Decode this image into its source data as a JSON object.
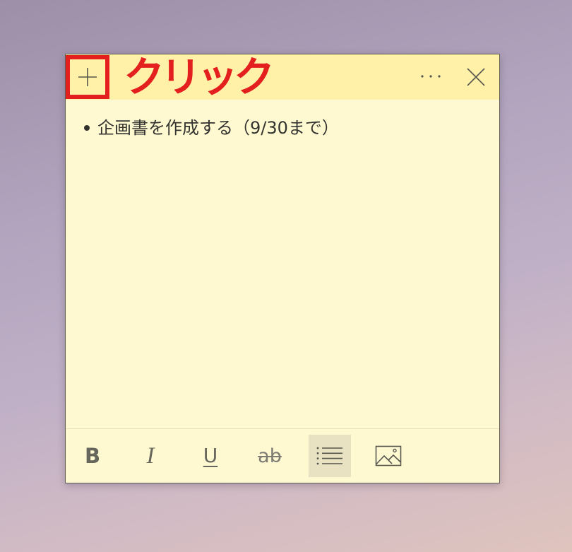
{
  "header": {
    "annotation": "クリック",
    "add_icon": "plus-icon",
    "more_icon": "more-icon",
    "close_icon": "close-icon"
  },
  "note": {
    "items": [
      {
        "text": "企画書を作成する（9/30まで）"
      }
    ]
  },
  "toolbar": {
    "bold": "B",
    "italic": "I",
    "underline": "U",
    "strikethrough": "ab",
    "bullets_icon": "bullet-list-icon",
    "image_icon": "image-icon",
    "bullets_active": true
  },
  "colors": {
    "header_bg": "#fff2a8",
    "body_bg": "#fff9d2",
    "annotation": "#e4201f",
    "icon": "#55554d",
    "active_button_bg": "#e8e2c3"
  }
}
